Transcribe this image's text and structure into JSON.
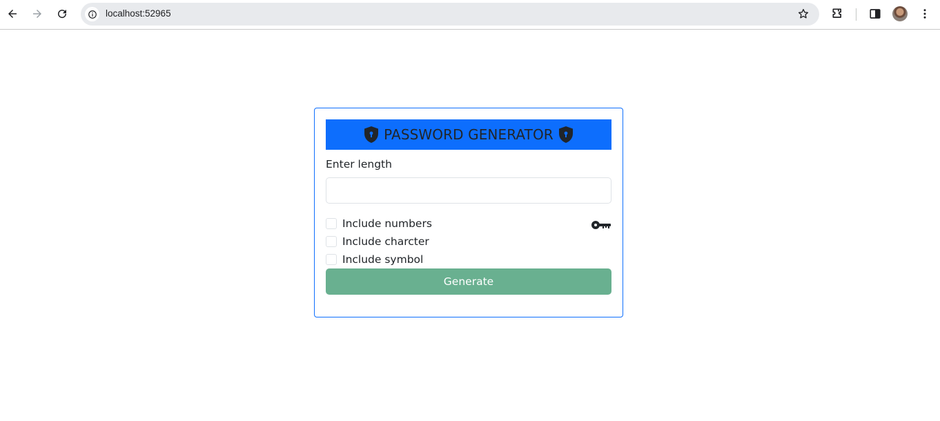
{
  "browser": {
    "url": "localhost:52965"
  },
  "app": {
    "title": "PASSWORD GENERATOR",
    "length_label": "Enter length",
    "length_input": {
      "value": "",
      "placeholder": ""
    },
    "options": [
      {
        "label": "Include numbers",
        "checked": false
      },
      {
        "label": "Include charcter",
        "checked": false
      },
      {
        "label": "Include symbol",
        "checked": false
      }
    ],
    "generate_label": "Generate",
    "icons": {
      "header": "shield-keyhole-icon",
      "decor": "key-icon"
    },
    "colors": {
      "header_bg": "#0d6efd",
      "card_border": "#0d6efd",
      "button_bg": "#69b090"
    }
  }
}
